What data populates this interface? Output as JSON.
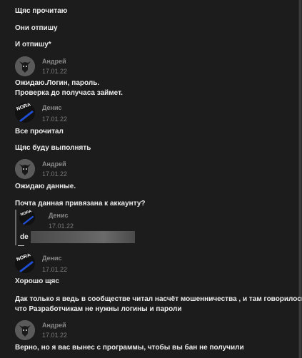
{
  "messages_top": [
    "Щяс прочитаю",
    "Они отпишу",
    "И отпишу*"
  ],
  "users": {
    "andrey": "Андрей",
    "denis": "Денис"
  },
  "date": "17.01.22",
  "blocks": {
    "b1": {
      "lines": [
        "Ожидаю.Логин, пароль.",
        "Проверка до получаса займет."
      ]
    },
    "b2": {
      "lines": [
        "Все прочитал",
        "Щяс буду выполнять"
      ]
    },
    "b3": {
      "lines": [
        "Ожидаю данные.",
        "Почта данная привязана к аккаунту?"
      ]
    },
    "quote": {
      "text": "de"
    },
    "b4": {
      "lines": [
        "Хорошо щяс",
        "Дак только я ведь в сообществе читал насчёт мошенничества , и там говорилось",
        "что Разработчикам не нужны логины и пароли"
      ]
    },
    "b5": {
      "lines": [
        "Верно, но я вас вынес с программы, чтобы вы бан не получили"
      ]
    }
  },
  "colors": {
    "background": "#1c1c1c",
    "text": "#ececec",
    "author": "#8a8a8a",
    "accent_blue": "#1f4fd6"
  }
}
